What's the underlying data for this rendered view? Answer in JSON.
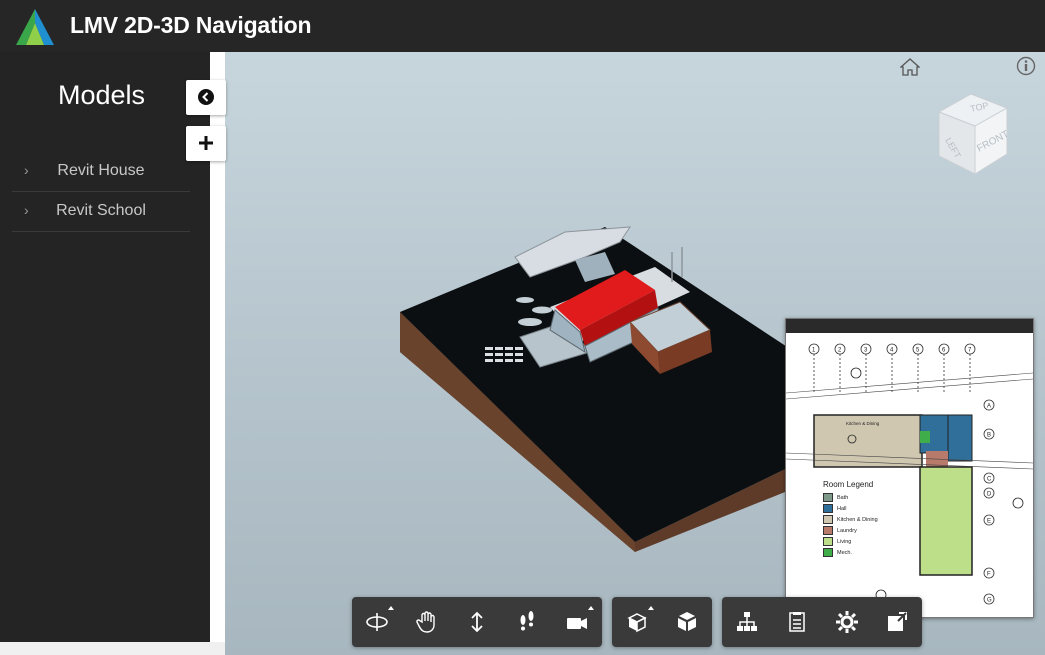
{
  "header": {
    "title": "LMV 2D-3D Navigation"
  },
  "sidebar": {
    "title": "Models",
    "items": [
      {
        "label": "Revit House",
        "chevron": "›"
      },
      {
        "label": "Revit School",
        "chevron": "›"
      }
    ]
  },
  "viewcube": {
    "top": "TOP",
    "left": "LEFT",
    "front": "FRONT"
  },
  "minimap": {
    "legend_title": "Room Legend",
    "legend": [
      {
        "label": "Bath",
        "color": "#7f9a8a"
      },
      {
        "label": "Hall",
        "color": "#2f6f99"
      },
      {
        "label": "Kitchen & Dining",
        "color": "#cfc7b0"
      },
      {
        "label": "Laundry",
        "color": "#b87a6a"
      },
      {
        "label": "Living",
        "color": "#bedf8a"
      },
      {
        "label": "Mech.",
        "color": "#3fae4a"
      }
    ],
    "grid_numbers": [
      "1",
      "2",
      "3",
      "4",
      "5",
      "6",
      "7"
    ],
    "grid_letters": [
      "A",
      "B",
      "C",
      "D",
      "E",
      "F",
      "G"
    ],
    "room_label": "Kitchen & Dining"
  },
  "icons": {
    "home": "home-icon",
    "info": "info-icon",
    "collapse": "chevron-left-circle-icon",
    "add": "plus-icon"
  },
  "toolbar": {
    "navigation": [
      "orbit-icon",
      "pan-icon",
      "zoom-icon",
      "walk-icon",
      "camera-icon"
    ],
    "model": [
      "explode-icon",
      "cube-icon"
    ],
    "settings": [
      "model-browser-icon",
      "properties-icon",
      "settings-icon",
      "fullscreen-icon"
    ]
  },
  "colors": {
    "header_bg": "#262626",
    "sidebar_bg": "#242424",
    "roof": "#e11b1b",
    "terrain_top": "#0c0f12",
    "terrain_side": "#5e3b28",
    "toolbar_bg": "#3a3a3a"
  }
}
